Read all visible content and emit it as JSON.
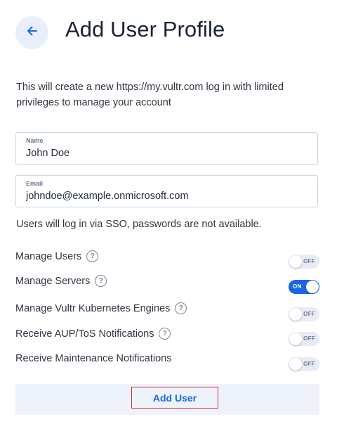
{
  "header": {
    "back_icon": "arrow-left-icon",
    "title": "Add User Profile"
  },
  "description": "This will create a new https://my.vultr.com log in with limited privileges to manage your account",
  "form": {
    "name": {
      "label": "Name",
      "value": "John Doe"
    },
    "email": {
      "label": "Email",
      "value": "johndoe@example.onmicrosoft.com"
    }
  },
  "sso_note": "Users will log in via SSO, passwords are not available.",
  "permissions": [
    {
      "label": "Manage Users",
      "help": true,
      "state": "OFF"
    },
    {
      "label": "Manage Servers",
      "help": true,
      "state": "ON"
    },
    {
      "label": "Manage Vultr Kubernetes Engines",
      "help": true,
      "state": "OFF"
    },
    {
      "label": "Receive AUP/ToS Notifications",
      "help": true,
      "state": "OFF"
    },
    {
      "label": "Receive Maintenance Notifications",
      "help": false,
      "state": "OFF"
    }
  ],
  "help_icon": "question-circle-icon",
  "help_glyph": "?",
  "footer": {
    "add_user_label": "Add User"
  },
  "colors": {
    "accent": "#1a66e6",
    "toggle_off_bg": "#e6ebf6",
    "footer_bg": "#eef2fb",
    "highlight_border": "#d32f2f"
  }
}
